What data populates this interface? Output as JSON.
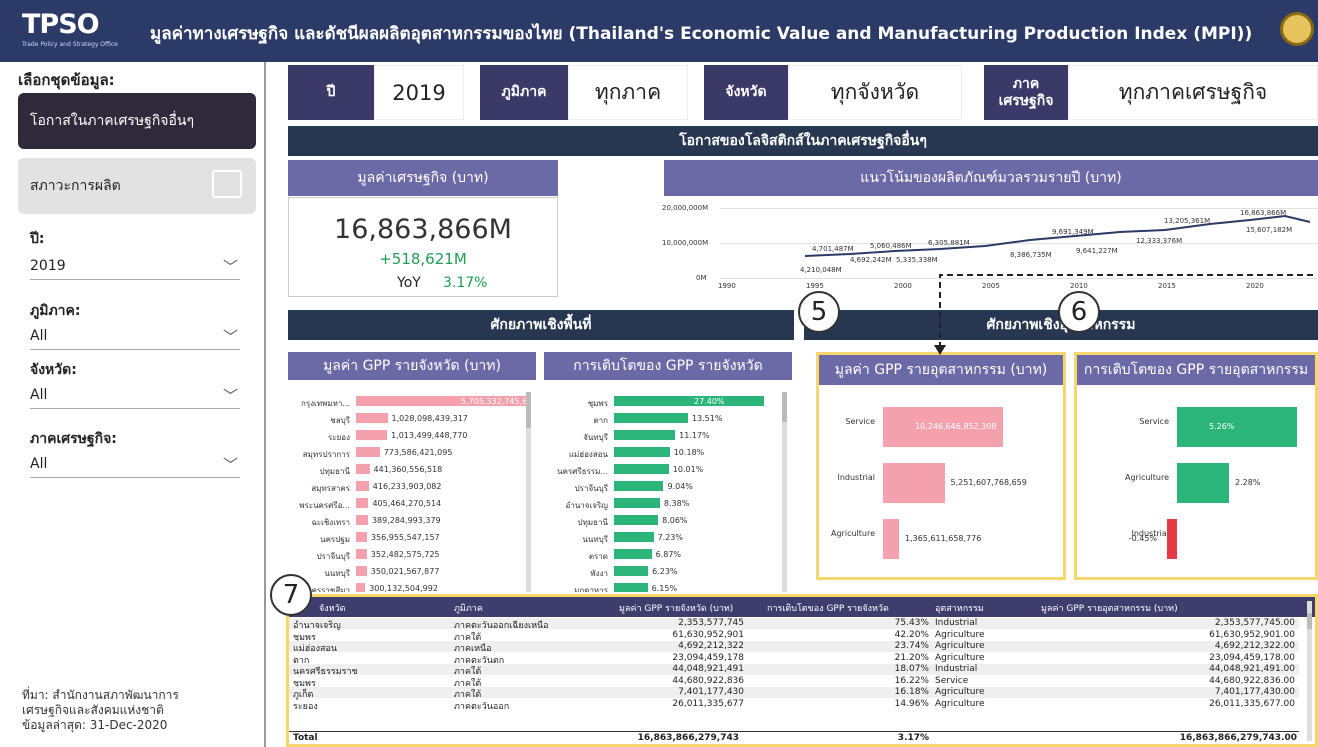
{
  "header": {
    "logo": "TPSO",
    "logo_sub": "Trade Policy and Strategy Office",
    "title": "มูลค่าทางเศรษฐกิจ และดัชนีผลผลิตอุตสาหกรรมของไทย (Thailand's Economic Value and Manufacturing Production Index (MPI))"
  },
  "sidebar": {
    "title": "เลือกชุดข้อมูล:",
    "btn_active": "โอกาสในภาคเศรษฐกิจอื่นๆ",
    "btn_other": "สภาวะการผลิต",
    "filters": [
      {
        "label": "ปี:",
        "value": "2019"
      },
      {
        "label": "ภูมิภาค:",
        "value": "All"
      },
      {
        "label": "จังหวัด:",
        "value": "All"
      },
      {
        "label": "ภาคเศรษฐกิจ:",
        "value": "All"
      }
    ],
    "source": [
      "ที่มา: สำนักงานสภาพัฒนาการ",
      "เศรษฐกิจและสังคมแห่งชาติ",
      "ข้อมูลล่าสุด: 31-Dec-2020"
    ]
  },
  "filterbar": {
    "year_label": "ปี",
    "year": "2019",
    "region_label": "ภูมิภาค",
    "region": "ทุกภาค",
    "province_label": "จังหวัด",
    "province": "ทุกจังหวัด",
    "sector_label": "ภาค เศรษฐกิจ",
    "sector": "ทุกภาคเศรษฐกิจ"
  },
  "banner_main": "โอกาสของโลจิสติกส์ในภาคเศรษฐกิจอื่นๆ",
  "kpi": {
    "title": "มูลค่าเศรษฐกิจ (บาท)",
    "value": "16,863,866M",
    "delta": "+518,621M",
    "yoy_label": "YoY",
    "yoy": "3.17%"
  },
  "trend": {
    "title": "แนวโน้มของผลิตภัณฑ์มวลรวมรายปี (บาท)",
    "yticks": [
      "20,000,000M",
      "10,000,000M",
      "0M"
    ],
    "xticks": [
      "1990",
      "1995",
      "2000",
      "2005",
      "2010",
      "2015",
      "2020"
    ],
    "labels": [
      "4,210,048M",
      "4,692,242M",
      "4,701,487M",
      "5,335,338M",
      "5,060,486M",
      "6,305,881M",
      "8,386,735M",
      "9,691,349M",
      "9,641,227M",
      "12,333,376M",
      "13,205,361M",
      "16,863,866M",
      "15,607,182M"
    ]
  },
  "area_banner": "ศักยภาพเชิงพื้นที่",
  "industry_banner": "ศักยภาพเชิงอุตสาหกรรม",
  "gpp_prov_title": "มูลค่า GPP รายจังหวัด (บาท)",
  "growth_prov_title": "การเติบโตของ GPP รายจังหวัด",
  "gpp_ind_title": "มูลค่า GPP รายอุตสาหกรรม (บาท)",
  "growth_ind_title": "การเติบโตของ GPP รายอุตสาหกรรม",
  "gpp_prov": [
    [
      "กรุงเทพมหา...",
      "5,705,332,745,666"
    ],
    [
      "ชลบุรี",
      "1,028,098,439,317"
    ],
    [
      "ระยอง",
      "1,013,499,448,770"
    ],
    [
      "สมุทรปราการ",
      "773,586,421,095"
    ],
    [
      "ปทุมธานี",
      "441,360,556,518"
    ],
    [
      "สมุทรสาคร",
      "416,233,903,082"
    ],
    [
      "พระนครศรีอ...",
      "405,464,270,514"
    ],
    [
      "ฉะเชิงเทรา",
      "389,284,993,379"
    ],
    [
      "นครปฐม",
      "356,955,547,157"
    ],
    [
      "ปราจีนบุรี",
      "352,482,575,725"
    ],
    [
      "นนทบุรี",
      "350,021,567,877"
    ],
    [
      "นครราชสีมา",
      "300,132,504,992"
    ]
  ],
  "gpp_prov_vals": [
    5705.3,
    1028.1,
    1013.5,
    773.6,
    441.4,
    416.2,
    405.5,
    389.3,
    357.0,
    352.5,
    350.0,
    300.1
  ],
  "growth_prov": [
    [
      "ชุมพร",
      "27.40%"
    ],
    [
      "ตาก",
      "13.51%"
    ],
    [
      "จันทบุรี",
      "11.17%"
    ],
    [
      "แม่ฮ่องสอน",
      "10.18%"
    ],
    [
      "นครศรีธรรม...",
      "10.01%"
    ],
    [
      "ปราจีนบุรี",
      "9.04%"
    ],
    [
      "อำนาจเจริญ",
      "8.38%"
    ],
    [
      "ปทุมธานี",
      "8.06%"
    ],
    [
      "นนทบุรี",
      "7.23%"
    ],
    [
      "ตราด",
      "6.87%"
    ],
    [
      "พังงา",
      "6.23%"
    ],
    [
      "มุกดาหาร",
      "6.15%"
    ]
  ],
  "growth_prov_vals": [
    27.4,
    13.51,
    11.17,
    10.18,
    10.01,
    9.04,
    8.38,
    8.06,
    7.23,
    6.87,
    6.23,
    6.15
  ],
  "gpp_ind": [
    [
      "Service",
      "10,246,646,852,308"
    ],
    [
      "Industrial",
      "5,251,607,768,659"
    ],
    [
      "Agriculture",
      "1,365,611,658,776"
    ]
  ],
  "growth_ind": [
    [
      "Service",
      "5.26%"
    ],
    [
      "Agriculture",
      "2.28%"
    ],
    [
      "Industrial",
      "-0.45%"
    ]
  ],
  "callouts": [
    "5",
    "6",
    "7"
  ],
  "table": {
    "headers": [
      "จังหวัด",
      "ภูมิภาค",
      "มูลค่า GPP รายจังหวัด (บาท)",
      "การเติบโตของ GPP รายจังหวัด",
      "อุตสาหกรรม",
      "มูลค่า GPP รายอุตสาหกรรม (บาท)"
    ],
    "rows": [
      [
        "อำนาจเจริญ",
        "ภาคตะวันออกเฉียงเหนือ",
        "2,353,577,745",
        "75.43%",
        "Industrial",
        "2,353,577,745.00"
      ],
      [
        "ชุมพร",
        "ภาคใต้",
        "61,630,952,901",
        "42.20%",
        "Agriculture",
        "61,630,952,901.00"
      ],
      [
        "แม่ฮ่องสอน",
        "ภาคเหนือ",
        "4,692,212,322",
        "23.74%",
        "Agriculture",
        "4,692,212,322.00"
      ],
      [
        "ตาก",
        "ภาคตะวันตก",
        "23,094,459,178",
        "21.20%",
        "Agriculture",
        "23,094,459,178.00"
      ],
      [
        "นครศรีธรรมราช",
        "ภาคใต้",
        "44,048,921,491",
        "18.07%",
        "Industrial",
        "44,048,921,491.00"
      ],
      [
        "ชุมพร",
        "ภาคใต้",
        "44,680,922,836",
        "16.22%",
        "Service",
        "44,680,922,836.00"
      ],
      [
        "ภูเก็ต",
        "ภาคใต้",
        "7,401,177,430",
        "16.18%",
        "Agriculture",
        "7,401,177,430.00"
      ],
      [
        "ระยอง",
        "ภาคตะวันออก",
        "26,011,335,677",
        "14.96%",
        "Agriculture",
        "26,011,335,677.00"
      ]
    ],
    "total": [
      "Total",
      "",
      "16,863,866,279,743",
      "3.17%",
      "",
      "16,863,866,279,743.00"
    ]
  }
}
